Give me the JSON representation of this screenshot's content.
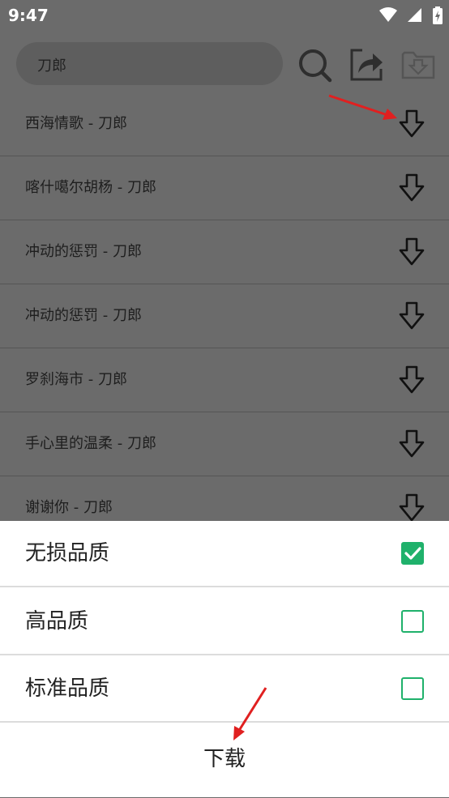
{
  "status_bar": {
    "time": "9:47"
  },
  "search": {
    "value": "刀郎"
  },
  "songs": [
    {
      "title": "西海情歌 - 刀郎"
    },
    {
      "title": "喀什噶尔胡杨 - 刀郎"
    },
    {
      "title": "冲动的惩罚 - 刀郎"
    },
    {
      "title": "冲动的惩罚 - 刀郎"
    },
    {
      "title": "罗刹海市 - 刀郎"
    },
    {
      "title": "手心里的温柔 - 刀郎"
    },
    {
      "title": "谢谢你 - 刀郎"
    }
  ],
  "quality_sheet": {
    "options": [
      {
        "label": "无损品质",
        "checked": true
      },
      {
        "label": "高品质",
        "checked": false
      },
      {
        "label": "标准品质",
        "checked": false
      }
    ],
    "download_label": "下载"
  },
  "colors": {
    "accent_green": "#1fb16b",
    "annotation_red": "#e02020",
    "dim_overlay": "#6b6b6b"
  },
  "icons": [
    "wifi-icon",
    "signal-icon",
    "battery-icon",
    "search-icon",
    "share-icon",
    "download-folder-icon",
    "download-arrow-icon",
    "checkbox-icon"
  ]
}
